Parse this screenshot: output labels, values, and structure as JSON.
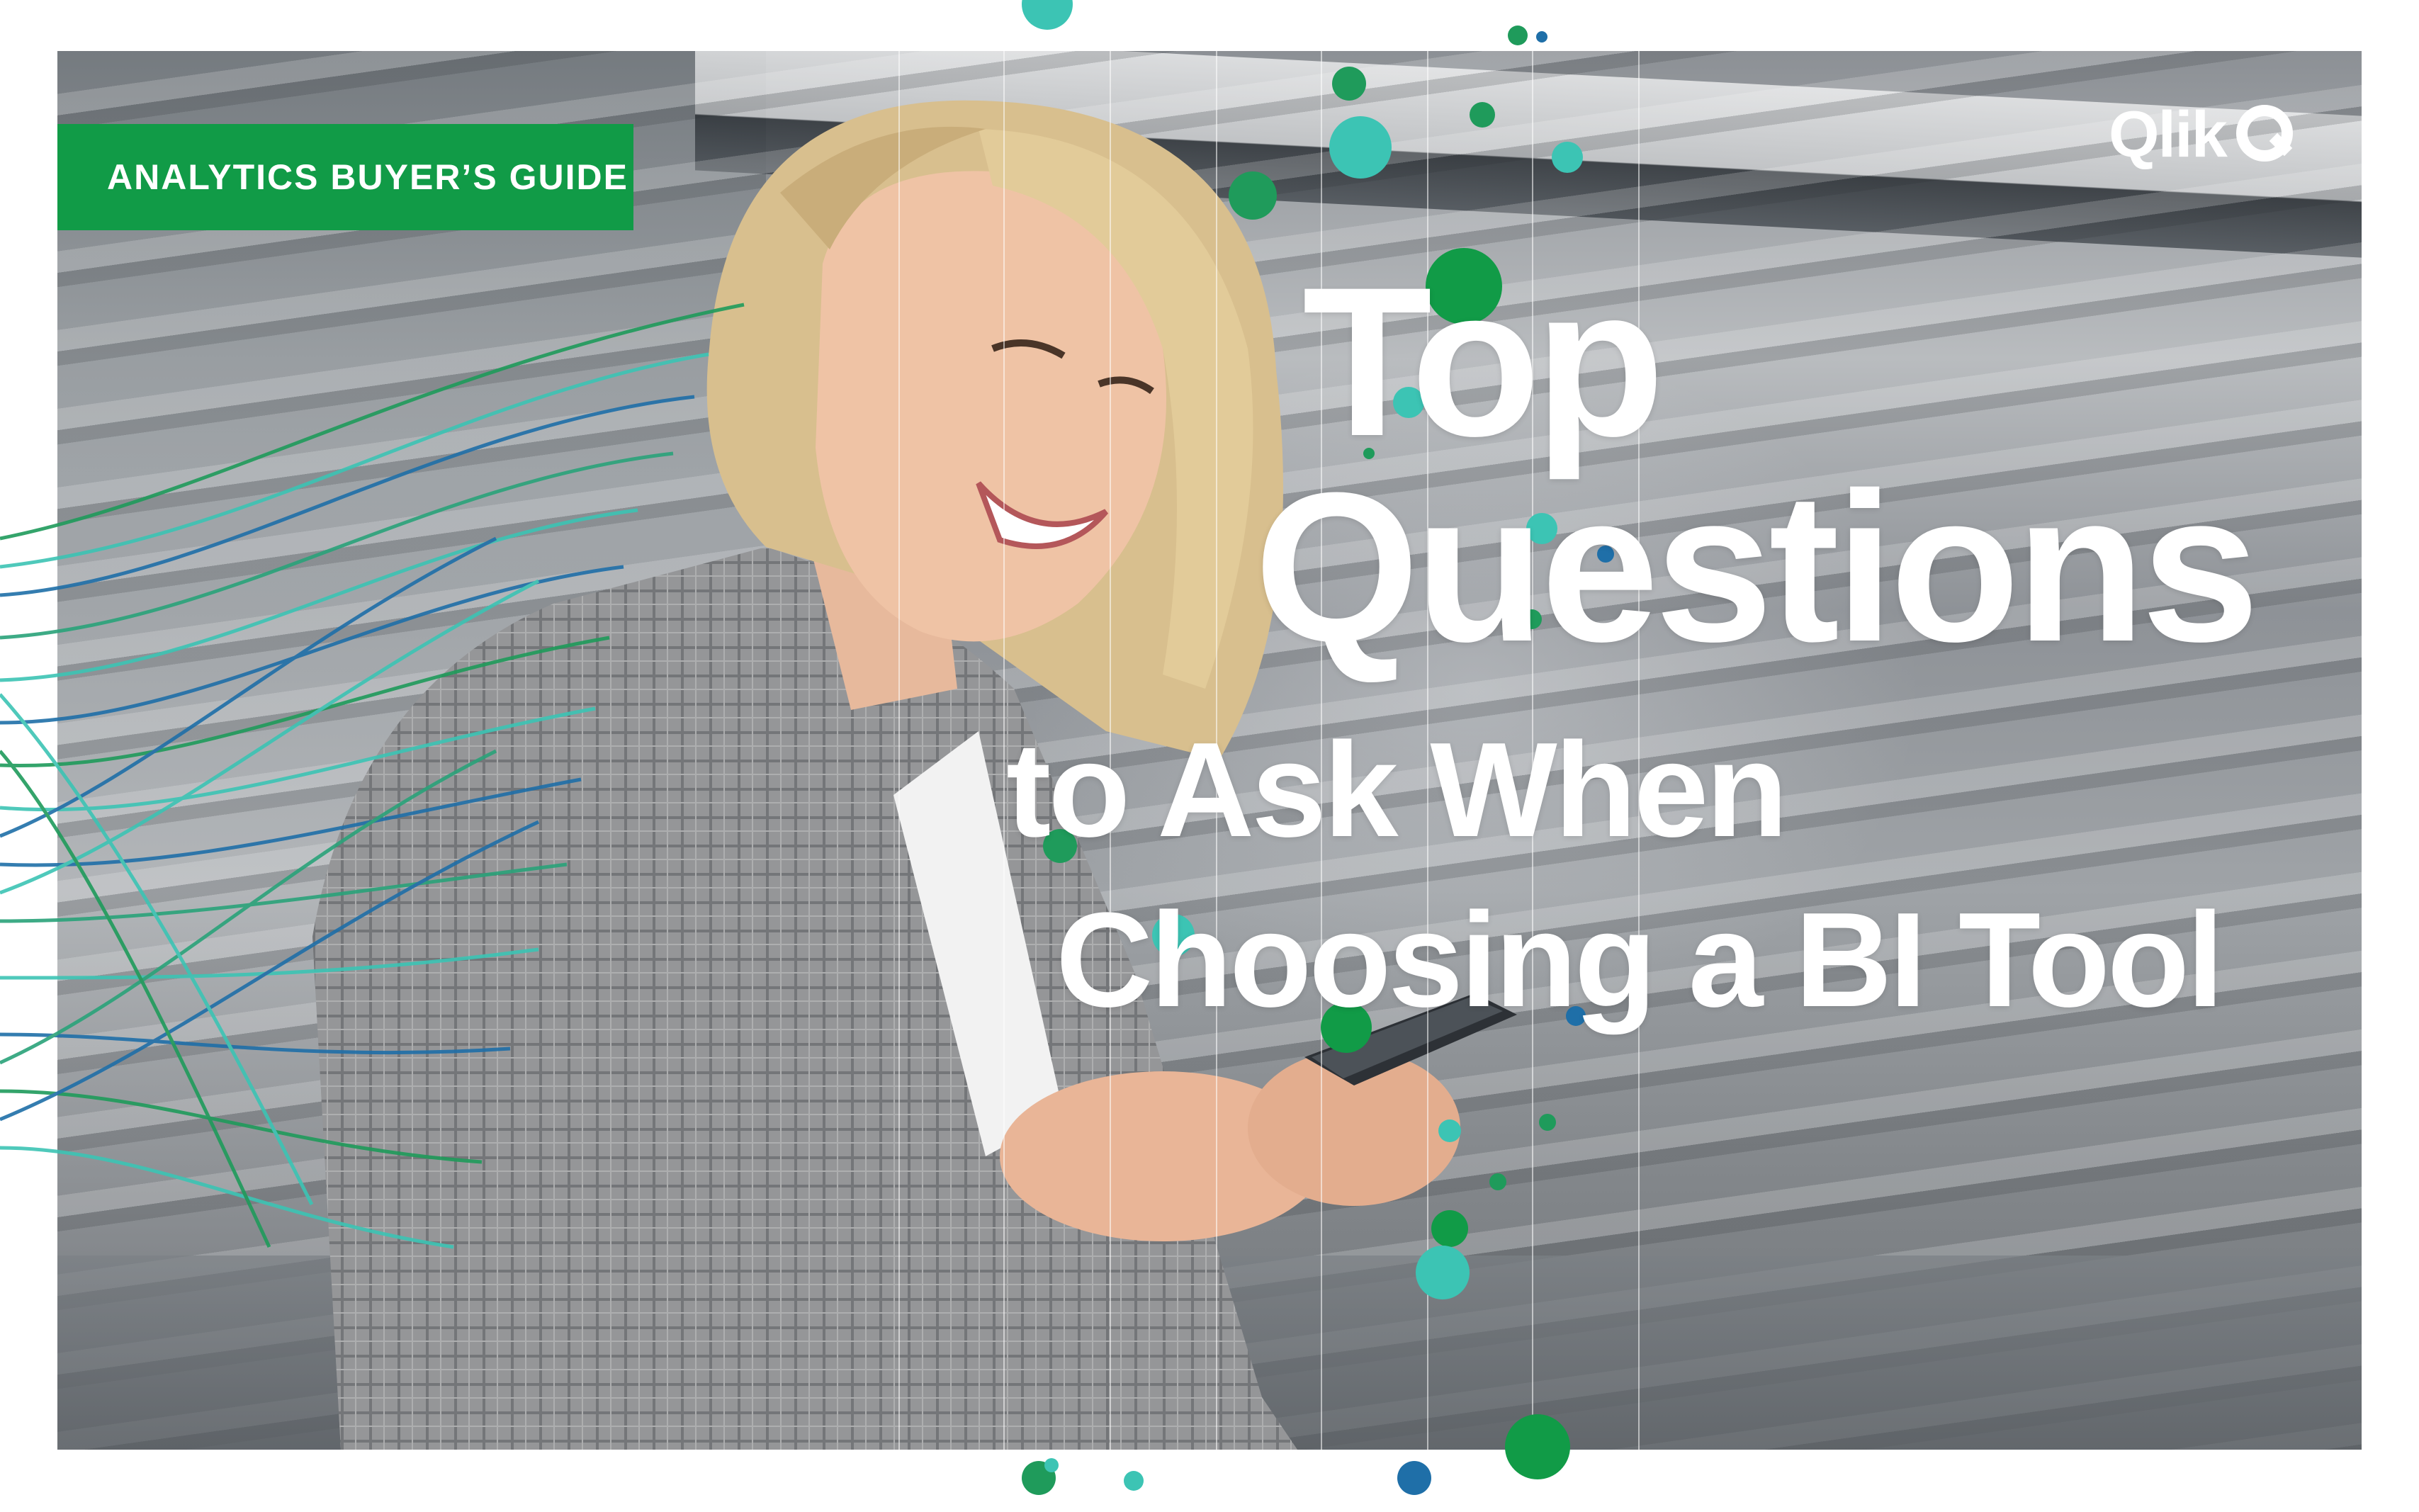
{
  "badge": {
    "label": "ANALYTICS BUYER’S GUIDE"
  },
  "brand": {
    "name": "Qlik",
    "primary_color": "#119b47",
    "accent_teal": "#3cc4b4",
    "accent_blue": "#1f6fa8"
  },
  "title": {
    "line1": "Top",
    "line2": "Questions",
    "line3": "to Ask When",
    "line4": "Choosing a BI Tool"
  },
  "hero": {
    "icon": "photo-woman-with-phone"
  }
}
